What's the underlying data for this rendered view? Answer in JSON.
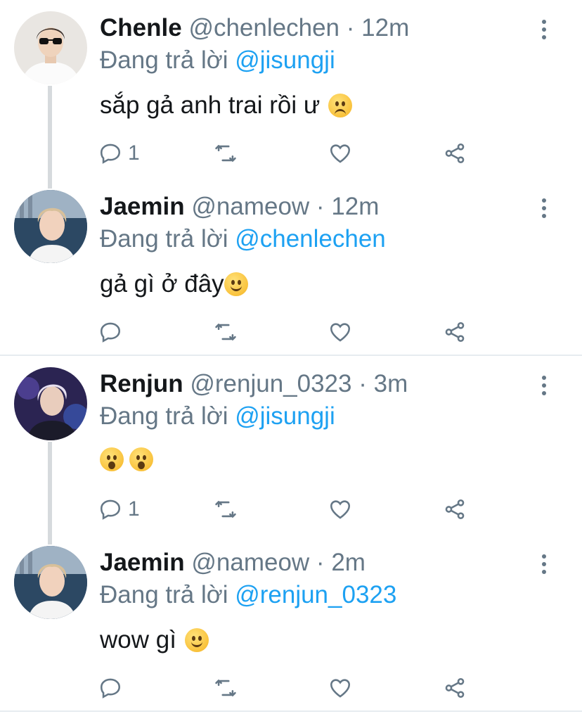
{
  "colors": {
    "accent": "#1da1f2",
    "secondary": "#657786",
    "text": "#14171a",
    "divider": "#e6ecf0",
    "thread_line": "#d6dadd"
  },
  "tweets": [
    {
      "name": "Chenle",
      "handle": "@chenlechen",
      "dot": "·",
      "time": "12m",
      "reply_prefix": "Đang trả lời",
      "reply_to": "@jisungji",
      "text": "sắp gả anh trai rồi ư",
      "emoji": [
        "disappointed-face"
      ],
      "reply_count": "1",
      "avatar": "chenle-avatar"
    },
    {
      "name": "Jaemin",
      "handle": "@nameow",
      "dot": "·",
      "time": "12m",
      "reply_prefix": "Đang trả lời",
      "reply_to": "@chenlechen",
      "text": "gả gì ở đây",
      "emoji": [
        "slightly-smiling-face"
      ],
      "reply_count": "",
      "avatar": "jaemin-avatar"
    },
    {
      "name": "Renjun",
      "handle": "@renjun_0323",
      "dot": "·",
      "time": "3m",
      "reply_prefix": "Đang trả lời",
      "reply_to": "@jisungji",
      "text": "",
      "emoji": [
        "hushed-face",
        "hushed-face"
      ],
      "reply_count": "1",
      "avatar": "renjun-avatar"
    },
    {
      "name": "Jaemin",
      "handle": "@nameow",
      "dot": "·",
      "time": "2m",
      "reply_prefix": "Đang trả lời",
      "reply_to": "@renjun_0323",
      "text": "wow gì",
      "emoji": [
        "slightly-smiling-face"
      ],
      "reply_count": "",
      "avatar": "jaemin-avatar"
    }
  ]
}
